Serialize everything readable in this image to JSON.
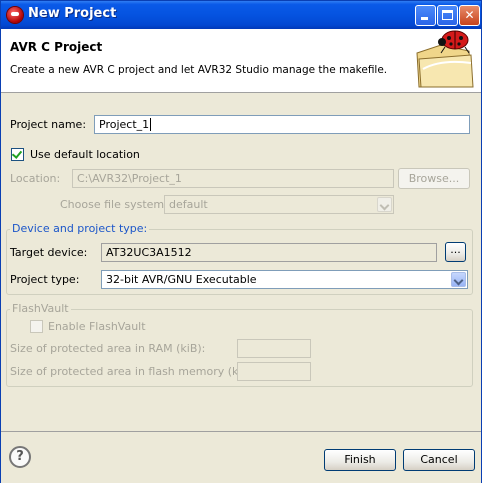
{
  "window": {
    "title": "New Project"
  },
  "header": {
    "title": "AVR C Project",
    "description": "Create a new AVR C project and let AVR32 Studio manage the makefile."
  },
  "form": {
    "project_name_label": "Project name:",
    "project_name_value": "Project_1",
    "use_default_location_label": "Use default location",
    "use_default_location_checked": true,
    "location_label": "Location:",
    "location_value": "C:\\AVR32\\Project_1",
    "browse_label": "Browse...",
    "file_system_label": "Choose file system:",
    "file_system_value": "default"
  },
  "device_group": {
    "legend": "Device and project type:",
    "target_device_label": "Target device:",
    "target_device_value": "AT32UC3A1512",
    "ellipsis_label": "...",
    "project_type_label": "Project type:",
    "project_type_value": "32-bit AVR/GNU Executable"
  },
  "flashvault": {
    "legend": "FlashVault",
    "enable_label": "Enable FlashVault",
    "ram_label": "Size of protected area in RAM (kiB):",
    "flash_label": "Size of protected area in flash memory (kiB):"
  },
  "footer": {
    "help_icon": "?",
    "finish_label": "Finish",
    "cancel_label": "Cancel"
  },
  "colors": {
    "title_bar": "#0553e0",
    "dialog_bg": "#ece9d8",
    "group_legend": "#1c56c9"
  }
}
